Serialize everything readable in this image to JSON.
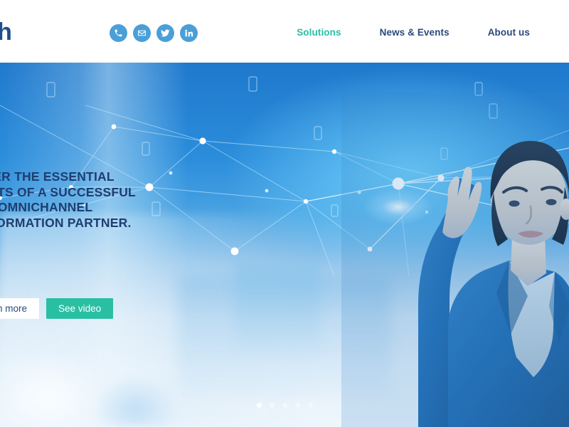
{
  "header": {
    "logo_text": "alth",
    "logo_color": "#1f4e8c",
    "social": [
      {
        "name": "phone-icon",
        "label": "Phone"
      },
      {
        "name": "email-icon",
        "label": "Email"
      },
      {
        "name": "twitter-icon",
        "label": "Twitter"
      },
      {
        "name": "linkedin-icon",
        "label": "LinkedIn"
      }
    ],
    "social_bg_color": "#4a9fd8",
    "nav": [
      {
        "label": "Solutions",
        "active": true
      },
      {
        "label": "News & Events",
        "active": false
      },
      {
        "label": "About us",
        "active": false
      }
    ],
    "nav_active_color": "#29bfa3",
    "nav_color": "#2b4a7d"
  },
  "hero": {
    "headline": "DISCOVER THE ESSENTIAL\nELEMENTS OF A SUCCESSFUL\nDIGITAL OMNICHANNEL\nTRANSFORMATION PARTNER.",
    "headline_color": "#1f3d70",
    "buttons": {
      "secondary_label": "Learn more",
      "primary_label": "See video",
      "primary_color": "#29bfa3"
    },
    "carousel": {
      "total": 5,
      "active_index": 0
    }
  }
}
